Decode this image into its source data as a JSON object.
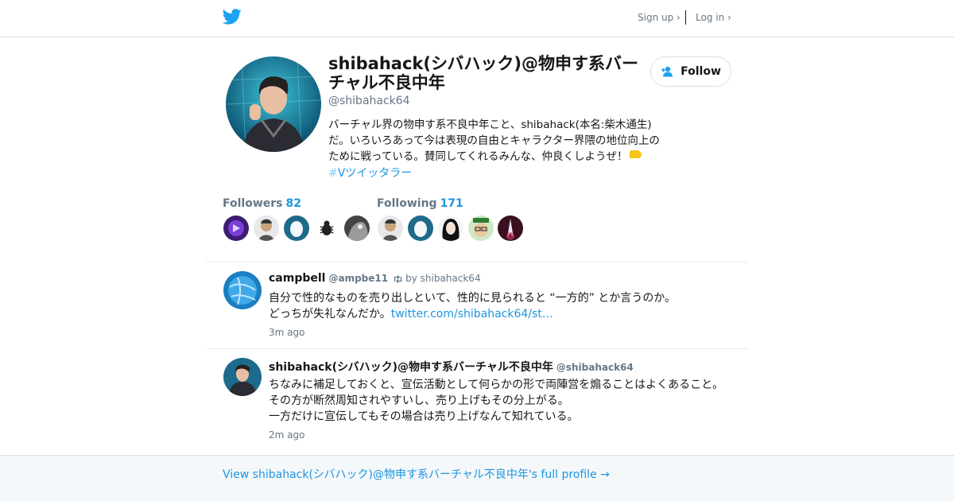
{
  "header": {
    "logo": "twitter-bird-icon",
    "signup_label": "Sign up ›",
    "login_label": "Log in ›"
  },
  "profile": {
    "display_name": "shibahack(シバハック)@物申す系バーチャル不良中年",
    "handle": "@shibahack64",
    "bio": "バーチャル界の物申す系不良中年こと、shibahack(本名:柴木通生)だ。いろいろあって今は表現の自由とキャラクター界隈の地位向上のために戦っている。賛同してくれるみんな、仲良くしようぜ！",
    "hashtag_symbol": "#",
    "hashtag_text": "Vツイッタラー",
    "follow_label": "Follow"
  },
  "followers": {
    "label": "Followers",
    "count": "82"
  },
  "following": {
    "label": "Following",
    "count": "171"
  },
  "tweets": [
    {
      "name": "campbell",
      "handle": "@ampbe11",
      "retweet_label": "by shibahack64",
      "line1": "自分で性的なものを売り出しといて、性的に見られると “一方的” とか言うのか。",
      "line2": "どっちが失礼なんだか。",
      "link": "twitter.com/shibahack64/st…",
      "time": "3m ago"
    },
    {
      "name": "shibahack(シバハック)@物申す系バーチャル不良中年",
      "handle": "@shibahack64",
      "line1": "ちなみに補足しておくと、宣伝活動として何らかの形で両陣営を煽ることはよくあること。",
      "line2": "その方が断然周知されやすいし、売り上げもその分上がる。",
      "line3": "一方だけに宣伝してもその場合は売り上げなんて知れている。",
      "time": "2m ago"
    }
  ],
  "footer": {
    "full_profile_label": "View shibahack(シバハック)@物申す系バーチャル不良中年's full profile →"
  },
  "colors": {
    "brand": "#1da1f2",
    "link": "#1b95e0",
    "muted": "#657786",
    "border": "#e6ecf0"
  }
}
